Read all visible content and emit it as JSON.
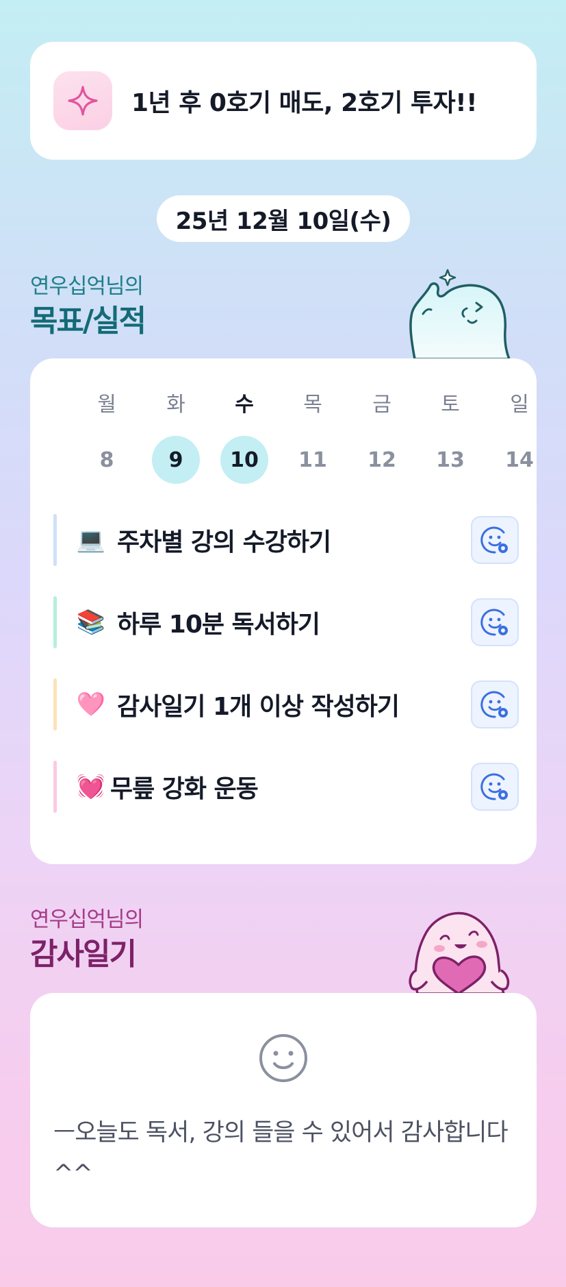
{
  "motto": {
    "icon": "sparkle-icon",
    "text": "1년 후 0호기 매도, 2호기 투자!!"
  },
  "date_label": "25년 12월 10일(수)",
  "goals_section": {
    "subtitle": "연우십억님의",
    "title": "목표/실적"
  },
  "week": {
    "days": [
      {
        "name": "월",
        "num": "8",
        "done": false,
        "today": false
      },
      {
        "name": "화",
        "num": "9",
        "done": true,
        "today": false
      },
      {
        "name": "수",
        "num": "10",
        "done": true,
        "today": true
      },
      {
        "name": "목",
        "num": "11",
        "done": false,
        "today": false
      },
      {
        "name": "금",
        "num": "12",
        "done": false,
        "today": false
      },
      {
        "name": "토",
        "num": "13",
        "done": false,
        "today": false
      },
      {
        "name": "일",
        "num": "14",
        "done": false,
        "today": false
      }
    ],
    "done_color": "#c3eef3"
  },
  "goals": [
    {
      "emoji": "💻",
      "text": "주차별 강의 수강하기",
      "bar_color": "#cfe0f7"
    },
    {
      "emoji": "📚",
      "text": "하루 10분 독서하기",
      "bar_color": "#b6efdb"
    },
    {
      "emoji": "🩷",
      "text": "감사일기 1개 이상 작성하기",
      "bar_color": "#fde2b8"
    },
    {
      "emoji": "💓",
      "text": "무릎 강화 운동",
      "bar_color": "#fbc9e2"
    }
  ],
  "goal_button_icon": "smile-face-add-icon",
  "gratitude_section": {
    "subtitle": "연우십억님의",
    "title": "감사일기"
  },
  "gratitude_entry": {
    "icon": "smile-face-icon",
    "text": "ㅡ오늘도 독서, 강의 들을 수 있어서 감사합니다 ^^"
  },
  "colors": {
    "goal_title": "#136b77",
    "gratitude_title": "#7d2168",
    "button_bg": "#edf3ff"
  }
}
